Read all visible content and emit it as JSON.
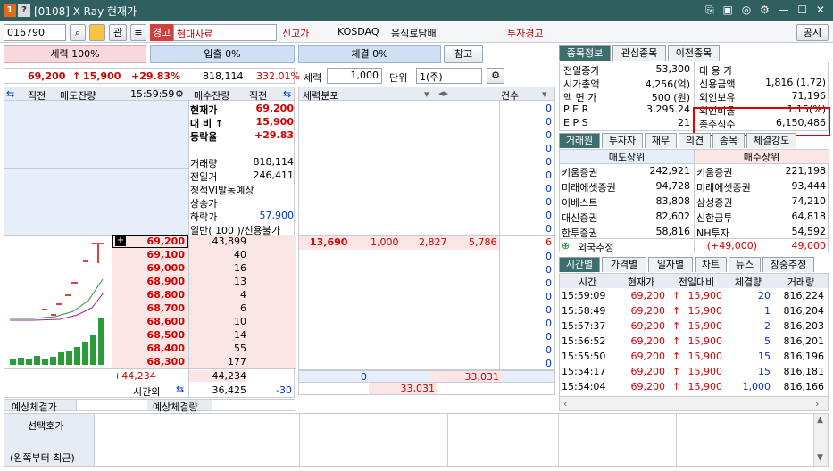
{
  "window": {
    "badge": "1",
    "help": "?",
    "title": "[0108] X-Ray 현재가",
    "icons": "⎘ ▣ ◎ ⚙ — ☐ ✕"
  },
  "toolbar": {
    "code": "016790",
    "search_icon": "⌕",
    "kwan": "관",
    "warn_badge": "경고",
    "stock_name": "현대사료",
    "newhigh": "신고가",
    "market": "KOSDAQ",
    "sector": "음식료담배",
    "invest_warn": "투자경고",
    "notice": "공시"
  },
  "stats": {
    "power_label": "세력 100%",
    "inflow_label": "입출 0%",
    "exec_label": "체결 0%",
    "ref_btn": "참고",
    "price": "69,200",
    "arrow": "↑",
    "change": "15,900",
    "rate": "+29.83%",
    "volume": "818,114",
    "vol_rate": "332.01%",
    "power_field": "세력",
    "power_val": "1,000",
    "unit_label": "단위",
    "unit_val": "1(주)"
  },
  "orderbook": {
    "headers": {
      "prev": "직전",
      "sell_rem": "매도잔량",
      "time": "15:59:59",
      "buy_rem": "매수잔량",
      "prev2": "직전"
    },
    "info": [
      {
        "label": "현재가",
        "value": "69,200"
      },
      {
        "label": "대 비 ↑",
        "value": "15,900"
      },
      {
        "label": "등락율",
        "value": "+29.83"
      },
      {
        "label": "",
        "value": ""
      },
      {
        "label": "거래량",
        "value": "818,114"
      },
      {
        "label": "전일거",
        "value": "246,411"
      },
      {
        "label": "정적VI발동예상",
        "value": ""
      },
      {
        "label": "상승가",
        "value": ""
      },
      {
        "label": "하락가",
        "value": "57,900"
      },
      {
        "label": "일반( 100 )/신용불가",
        "value": ""
      }
    ],
    "bids": [
      {
        "price": "69,200",
        "qty": "43,899"
      },
      {
        "price": "69,100",
        "qty": "40"
      },
      {
        "price": "69,000",
        "qty": "16"
      },
      {
        "price": "68,900",
        "qty": "13"
      },
      {
        "price": "68,800",
        "qty": "4"
      },
      {
        "price": "68,700",
        "qty": "6"
      },
      {
        "price": "68,600",
        "qty": "10"
      },
      {
        "price": "68,500",
        "qty": "14"
      },
      {
        "price": "68,400",
        "qty": "55"
      },
      {
        "price": "68,300",
        "qty": "177"
      }
    ],
    "sum_diff": "+44,234",
    "sum_qty": "44,234",
    "after_label": "시간외",
    "after_qty": "36,425",
    "after_diff": "-30",
    "exp_price": "예상체결가",
    "exp_qty": "예상체결량"
  },
  "dist": {
    "title": "세력분포",
    "count_label": "건수",
    "counts": [
      "0",
      "0",
      "0",
      "0",
      "0",
      "0",
      "0",
      "0",
      "0",
      "0"
    ],
    "row": {
      "price": "13,690",
      "a": "1,000",
      "b": "2,827",
      "c": "5,786",
      "n": "6"
    },
    "lower_counts": [
      "0",
      "0",
      "0",
      "0",
      "0",
      "0",
      "0",
      "0",
      "0"
    ],
    "foot1": "0",
    "foot2": "33,031",
    "foot3": "33,031"
  },
  "info_tabs": [
    "종목정보",
    "관심종목",
    "이전종목"
  ],
  "info": {
    "left": [
      {
        "k": "전일종가",
        "v": "53,300"
      },
      {
        "k": "시가총액",
        "v": "4,256(억)"
      },
      {
        "k": "액 면 가",
        "v": "500 (원)"
      },
      {
        "k": "P E R",
        "v": "3,295.24"
      },
      {
        "k": "E P S",
        "v": "21"
      }
    ],
    "right": [
      {
        "k": "대 용 가",
        "v": ""
      },
      {
        "k": "신용금액",
        "v": "1,816   (1.72)"
      },
      {
        "k": "외인보유",
        "v": "71,196"
      },
      {
        "k": "외인비율",
        "v": "1.15(%)"
      },
      {
        "k": "총주식수",
        "v": "6,150,486"
      }
    ]
  },
  "broker_tabs": [
    "거래원",
    "투자자",
    "재무",
    "의견",
    "종목",
    "체결강도"
  ],
  "broker": {
    "sell_top": "매도상위",
    "buy_top": "매수상위",
    "rows": [
      {
        "s": "키움증권",
        "sq": "242,921",
        "b": "키움증권",
        "bq": "221,198"
      },
      {
        "s": "미래에셋증권",
        "sq": "94,728",
        "b": "미래에셋증권",
        "bq": "93,444"
      },
      {
        "s": "이베스트",
        "sq": "83,808",
        "b": "삼성증권",
        "bq": "74,210"
      },
      {
        "s": "대신증권",
        "sq": "82,602",
        "b": "신한금투",
        "bq": "64,818"
      },
      {
        "s": "한투증권",
        "sq": "58,816",
        "b": "NH투자",
        "bq": "54,592"
      }
    ],
    "foreign": "외국추정",
    "foreign_diff": "(+49,000)",
    "foreign_qty": "49,000"
  },
  "time_tabs": [
    "시간별",
    "가격별",
    "일자별",
    "차트",
    "뉴스",
    "장중추정"
  ],
  "ticks": {
    "headers": [
      "시간",
      "현재가",
      "전일대비",
      "체결량",
      "거래량"
    ],
    "rows": [
      {
        "t": "15:59:09",
        "p": "69,200",
        "d": "15,900",
        "q": "20",
        "v": "816,224"
      },
      {
        "t": "15:58:49",
        "p": "69,200",
        "d": "15,900",
        "q": "1",
        "v": "816,204"
      },
      {
        "t": "15:57:37",
        "p": "69,200",
        "d": "15,900",
        "q": "2",
        "v": "816,203"
      },
      {
        "t": "15:56:52",
        "p": "69,200",
        "d": "15,900",
        "q": "5",
        "v": "816,201"
      },
      {
        "t": "15:55:50",
        "p": "69,200",
        "d": "15,900",
        "q": "15",
        "v": "816,196"
      },
      {
        "t": "15:54:17",
        "p": "69,200",
        "d": "15,900",
        "q": "15",
        "v": "816,181"
      },
      {
        "t": "15:54:04",
        "p": "69,200",
        "d": "15,900",
        "q": "1,000",
        "v": "816,166"
      }
    ]
  },
  "bottom": {
    "sel_label": "선택호가",
    "recent_label": "(왼쪽부터 최근)"
  },
  "colors": {
    "title_bg": "#2f5f5f",
    "red": "#d40000",
    "blue": "#0033cc",
    "highlight": "#e00000"
  }
}
